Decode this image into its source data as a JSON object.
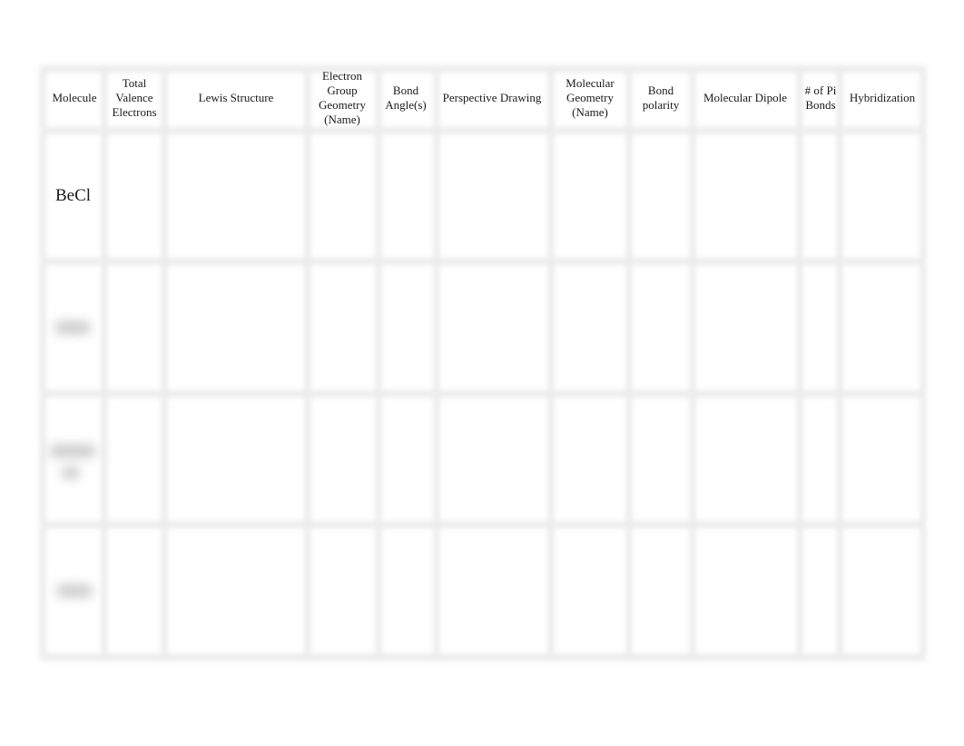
{
  "table": {
    "headers": [
      "Molecule",
      "Total Valence Electrons",
      "Lewis Structure",
      "Electron Group Geometry (Name)",
      "Bond Angle(s)",
      "Perspective Drawing",
      "Molecular Geometry (Name)",
      "Bond polarity",
      "Molecular Dipole",
      "# of Pi Bonds",
      "Hybridization"
    ],
    "rows": [
      {
        "molecule": "BeCl",
        "obscured": false
      },
      {
        "molecule": "",
        "obscured": true
      },
      {
        "molecule": "",
        "obscured": true
      },
      {
        "molecule": "",
        "obscured": true
      }
    ]
  }
}
